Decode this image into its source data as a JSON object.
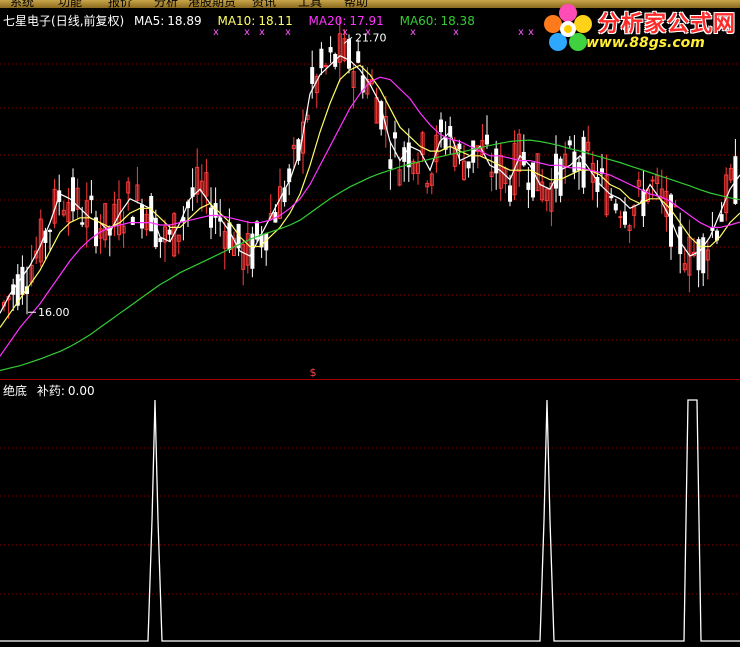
{
  "menu": {
    "items": [
      "系统",
      "功能",
      "报价",
      "分析",
      "港股期货",
      "资讯",
      "工具",
      "帮助"
    ]
  },
  "header": {
    "stock_name": "七星电子",
    "period": "(日线,前复权)",
    "ma5_label": "MA5:",
    "ma5_value": "18.89",
    "ma10_label": "MA10:",
    "ma10_value": "18.11",
    "ma20_label": "MA20:",
    "ma20_value": "17.91",
    "ma60_label": "MA60:",
    "ma60_value": "18.38"
  },
  "indicator": {
    "name": "绝底",
    "series_label": "补药:",
    "value": "0.00"
  },
  "logo": {
    "title": "分析家公式网",
    "url": "www.88gs.com"
  },
  "annotations": {
    "high_label": "21.70",
    "low_label": "16.00",
    "marker_glyph": "$"
  },
  "colors": {
    "up": "#ff3c3c",
    "down": "#ffffff",
    "ma5": "#ffffff",
    "ma10": "#ffff66",
    "ma20": "#ff33ff",
    "ma60": "#33cc33",
    "grid": "#8b0000",
    "marker": "#ff55ff",
    "indicator_line": "#ffffff"
  },
  "chart_data": [
    {
      "type": "candlestick",
      "title": "七星电子(日线,前复权)",
      "ylim": [
        14.6,
        22.4
      ],
      "grid": true,
      "series": [
        {
          "name": "MA5",
          "color": "#ffffff",
          "x": [
            0,
            10,
            20,
            30,
            40,
            50,
            60,
            70,
            80,
            90,
            100,
            110,
            120,
            130,
            140,
            150,
            160,
            170,
            180,
            190,
            200,
            210,
            220,
            230,
            240,
            250,
            260,
            270,
            280,
            290,
            300,
            310,
            320,
            330,
            340,
            350,
            360,
            370,
            380,
            390,
            400,
            410,
            420,
            430,
            440,
            450,
            460,
            470,
            480,
            490,
            500,
            510,
            520,
            530,
            540,
            550,
            560,
            570,
            580,
            590,
            600,
            610,
            620,
            630,
            640,
            650,
            660,
            670,
            680,
            690,
            700,
            710,
            720,
            730,
            740
          ],
          "y": [
            16.0,
            16.4,
            16.7,
            17.0,
            17.4,
            17.9,
            18.5,
            18.4,
            18.2,
            18.0,
            17.9,
            17.7,
            18.1,
            18.4,
            18.3,
            18.2,
            17.6,
            17.5,
            17.9,
            18.4,
            18.6,
            18.3,
            18.0,
            17.7,
            17.3,
            17.2,
            17.6,
            18.0,
            18.4,
            18.8,
            19.4,
            20.6,
            21.0,
            21.2,
            21.4,
            21.3,
            21.1,
            20.8,
            20.4,
            19.6,
            19.2,
            19.5,
            19.4,
            19.0,
            19.6,
            19.8,
            19.2,
            19.3,
            19.5,
            19.1,
            19.0,
            18.8,
            19.3,
            19.1,
            18.7,
            18.6,
            19.0,
            19.1,
            19.3,
            19.0,
            18.7,
            18.5,
            18.4,
            18.2,
            18.3,
            18.7,
            18.4,
            18.0,
            17.5,
            17.2,
            17.3,
            17.6,
            18.1,
            18.6,
            18.9
          ]
        },
        {
          "name": "MA10",
          "color": "#ffff66",
          "x": [
            0,
            10,
            20,
            30,
            40,
            50,
            60,
            70,
            80,
            90,
            100,
            110,
            120,
            130,
            140,
            150,
            160,
            170,
            180,
            190,
            200,
            210,
            220,
            230,
            240,
            250,
            260,
            270,
            280,
            290,
            300,
            310,
            320,
            330,
            340,
            350,
            360,
            370,
            380,
            390,
            400,
            410,
            420,
            430,
            440,
            450,
            460,
            470,
            480,
            490,
            500,
            510,
            520,
            530,
            540,
            550,
            560,
            570,
            580,
            590,
            600,
            610,
            620,
            630,
            640,
            650,
            660,
            670,
            680,
            690,
            700,
            710,
            720,
            730,
            740
          ],
          "y": [
            15.7,
            16.0,
            16.3,
            16.6,
            16.9,
            17.3,
            17.7,
            17.9,
            18.0,
            18.0,
            17.9,
            17.8,
            17.9,
            18.1,
            18.2,
            18.2,
            18.0,
            17.8,
            17.8,
            18.0,
            18.2,
            18.3,
            18.1,
            17.9,
            17.6,
            17.4,
            17.4,
            17.6,
            17.8,
            18.1,
            18.5,
            19.1,
            19.8,
            20.4,
            20.9,
            21.1,
            21.2,
            21.0,
            20.7,
            20.3,
            19.9,
            19.7,
            19.5,
            19.4,
            19.4,
            19.5,
            19.4,
            19.3,
            19.3,
            19.2,
            19.1,
            19.0,
            19.0,
            19.0,
            18.9,
            18.8,
            18.8,
            18.9,
            19.0,
            19.0,
            18.9,
            18.7,
            18.6,
            18.4,
            18.3,
            18.4,
            18.4,
            18.2,
            17.9,
            17.6,
            17.4,
            17.4,
            17.6,
            17.9,
            18.1
          ]
        },
        {
          "name": "MA20",
          "color": "#ff33ff",
          "x": [
            0,
            10,
            20,
            30,
            40,
            50,
            60,
            70,
            80,
            90,
            100,
            110,
            120,
            130,
            140,
            150,
            160,
            170,
            180,
            190,
            200,
            210,
            220,
            230,
            240,
            250,
            260,
            270,
            280,
            290,
            300,
            310,
            320,
            330,
            340,
            350,
            360,
            370,
            380,
            390,
            400,
            410,
            420,
            430,
            440,
            450,
            460,
            470,
            480,
            490,
            500,
            510,
            520,
            530,
            540,
            550,
            560,
            570,
            580,
            590,
            600,
            610,
            620,
            630,
            640,
            650,
            660,
            670,
            680,
            690,
            700,
            710,
            720,
            730,
            740
          ],
          "y": [
            15.1,
            15.4,
            15.7,
            15.95,
            16.2,
            16.5,
            16.8,
            17.1,
            17.35,
            17.55,
            17.7,
            17.8,
            17.85,
            17.9,
            17.9,
            17.9,
            17.85,
            17.85,
            17.9,
            17.95,
            18.0,
            18.05,
            18.05,
            18.0,
            17.95,
            17.9,
            17.9,
            17.95,
            18.05,
            18.2,
            18.4,
            18.7,
            19.1,
            19.5,
            19.9,
            20.3,
            20.6,
            20.85,
            20.95,
            20.9,
            20.7,
            20.5,
            20.2,
            19.95,
            19.75,
            19.65,
            19.6,
            19.5,
            19.4,
            19.3,
            19.3,
            19.25,
            19.2,
            19.2,
            19.15,
            19.1,
            19.1,
            19.05,
            19.05,
            19.0,
            18.95,
            18.9,
            18.8,
            18.7,
            18.6,
            18.5,
            18.45,
            18.35,
            18.2,
            18.05,
            17.9,
            17.8,
            17.8,
            17.85,
            17.91
          ]
        },
        {
          "name": "MA60",
          "color": "#33cc33",
          "x": [
            0,
            10,
            20,
            30,
            40,
            50,
            60,
            70,
            80,
            90,
            100,
            110,
            120,
            130,
            140,
            150,
            160,
            170,
            180,
            190,
            200,
            210,
            220,
            230,
            240,
            250,
            260,
            270,
            280,
            290,
            300,
            310,
            320,
            330,
            340,
            350,
            360,
            370,
            380,
            390,
            400,
            410,
            420,
            430,
            440,
            450,
            460,
            470,
            480,
            490,
            500,
            510,
            520,
            530,
            540,
            550,
            560,
            570,
            580,
            590,
            600,
            610,
            620,
            630,
            640,
            650,
            660,
            670,
            680,
            690,
            700,
            710,
            720,
            730,
            740
          ],
          "y": [
            14.8,
            14.85,
            14.9,
            14.97,
            15.04,
            15.12,
            15.2,
            15.3,
            15.42,
            15.55,
            15.7,
            15.85,
            16.0,
            16.15,
            16.3,
            16.45,
            16.6,
            16.72,
            16.85,
            16.95,
            17.05,
            17.15,
            17.25,
            17.35,
            17.45,
            17.55,
            17.63,
            17.7,
            17.77,
            17.85,
            17.95,
            18.1,
            18.25,
            18.4,
            18.53,
            18.65,
            18.75,
            18.85,
            18.93,
            19.0,
            19.07,
            19.13,
            19.18,
            19.23,
            19.28,
            19.33,
            19.37,
            19.42,
            19.47,
            19.52,
            19.56,
            19.6,
            19.62,
            19.63,
            19.6,
            19.56,
            19.51,
            19.45,
            19.4,
            19.34,
            19.28,
            19.22,
            19.16,
            19.09,
            19.02,
            18.95,
            18.88,
            18.81,
            18.74,
            18.67,
            18.59,
            18.52,
            18.47,
            18.42,
            18.38
          ]
        }
      ]
    },
    {
      "type": "line",
      "title": "绝底 补药",
      "ylim": [
        0,
        1
      ],
      "grid": true,
      "series": [
        {
          "name": "补药",
          "color": "#ffffff",
          "x": [
            0,
            148,
            152,
            155,
            158,
            162,
            540,
            544,
            547,
            550,
            554,
            684,
            688,
            697,
            701,
            740
          ],
          "y": [
            0,
            0,
            0.5,
            1,
            0.5,
            0,
            0,
            0.5,
            1,
            0.5,
            0,
            0,
            1,
            1,
            0,
            0
          ]
        }
      ]
    }
  ]
}
